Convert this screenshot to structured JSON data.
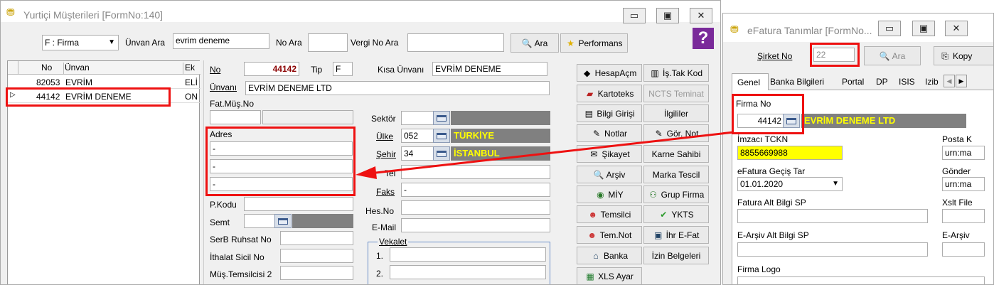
{
  "left_window": {
    "title": "Yurtiçi Müşterileri [FormNo:140]",
    "controls": {
      "minimize": "▭",
      "maximize": "▣",
      "close": "✕"
    },
    "search": {
      "type_select": "F : Firma",
      "unvan_label": "Ünvan Ara",
      "unvan_value": "evrim deneme",
      "no_label": "No Ara",
      "no_value": "",
      "vergi_label": "Vergi No Ara",
      "vergi_value": "",
      "ara_button": "Ara",
      "performans_button": "Performans"
    },
    "grid": {
      "columns": [
        "No",
        "Ünvan",
        "Ek"
      ],
      "rows": [
        {
          "no": "82053",
          "unvan": "EVRİM",
          "ek": "ELİ"
        },
        {
          "no": "44142",
          "unvan": "EVRİM DENEME",
          "ek": "ON"
        }
      ]
    },
    "form": {
      "no_label": "No",
      "no_value": "44142",
      "tip_label": "Tip",
      "tip_value": "F",
      "kisa_unvan_label": "Kısa Ünvanı",
      "kisa_unvan_value": "EVRİM DENEME",
      "unvan_label": "Ünvanı",
      "unvan_value": "EVRİM DENEME LTD",
      "fat_mus_no_label": "Fat.Müş.No",
      "sektor_label": "Sektör",
      "adres_label": "Adres",
      "adres_lines": [
        "-",
        "-",
        "-"
      ],
      "ulke_label": "Ülke",
      "ulke_code": "052",
      "ulke_name": "TÜRKİYE",
      "sehir_label": "Şehir",
      "sehir_code": "34",
      "sehir_name": "İSTANBUL",
      "tel_label": "Tel",
      "faks_label": "Faks",
      "faks_value": "-",
      "pkodu_label": "P.Kodu",
      "hesno_label": "Hes.No",
      "semt_label": "Semt",
      "email_label": "E-Mail",
      "serb_label": "SerB Ruhsat No",
      "ithalat_label": "İthalat Sicil No",
      "mus_temsilcisi_label": "Müş.Temsilcisi 2",
      "vekalet_label": "Vekalet",
      "vekalet_rows": [
        "1.",
        "2."
      ]
    },
    "side_buttons_left": [
      "HesapAçm",
      "Kartoteks",
      "Bilgi Girişi",
      "Notlar",
      "Şikayet",
      "Arşiv",
      "MİY",
      "Temsilci",
      "Tem.Not",
      "Banka",
      "XLS Ayar"
    ],
    "side_buttons_right": [
      "İş.Tak Kod",
      "NCTS Teminat",
      "İlgililer",
      "Gör. Not",
      "Karne Sahibi",
      "Marka Tescil",
      "Grup Firma",
      "YKTS",
      "İhr E-Fat",
      "İzin Belgeleri"
    ],
    "help_icon": "?"
  },
  "right_window": {
    "title": "eFatura Tanımlar [FormNo...",
    "sirket_label": "Şirket No",
    "sirket_value": "22",
    "ara_button": "Ara",
    "kopya_button": "Kopy",
    "tabs": [
      "Genel",
      "Banka Bilgileri",
      "Portal",
      "DP",
      "ISIS",
      "Izib"
    ],
    "firma_no_label": "Firma No",
    "firma_no_value": "44142",
    "firma_name": "EVRİM DENEME LTD",
    "imzaci_label": "İmzacı TCKN",
    "imzaci_value": "8855669988",
    "posta_label": "Posta K",
    "posta_value": "urn:ma",
    "gecis_label": "eFatura Geçiş Tar",
    "gecis_value": "01.01.2020",
    "gonderen_label": "Gönder",
    "gonderen_value": "urn:ma",
    "fatura_alt_label": "Fatura Alt Bilgi SP",
    "xslt_label": "Xslt File",
    "earsiv_alt_label": "E-Arşiv Alt Bilgi SP",
    "earsiv_label": "E-Arşiv",
    "logo_label": "Firma Logo"
  },
  "colors": {
    "highlight": "#ee1111",
    "yellow_text": "#ffff00",
    "gray_field": "#808080",
    "imzaci_bg": "#ffff00"
  }
}
